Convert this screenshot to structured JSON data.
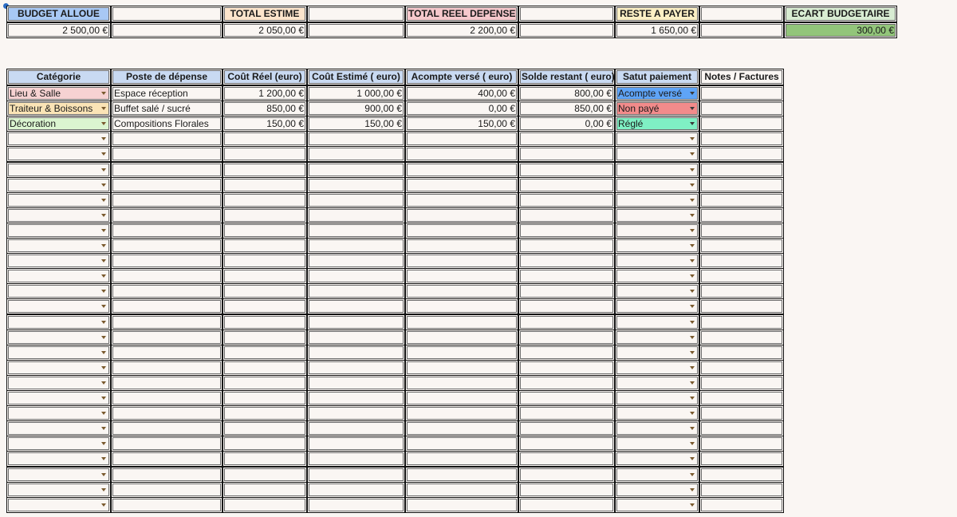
{
  "summary": [
    {
      "key": "budget",
      "label": "BUDGET ALLOUE",
      "value": "2 500,00 €",
      "label_bg": "#a8c8f4",
      "value_bg": "#faf6f3"
    },
    {
      "key": "blank1",
      "label": "",
      "value": "",
      "label_bg": "#faf6f3",
      "value_bg": "#faf6f3"
    },
    {
      "key": "estime",
      "label": "TOTAL ESTIME",
      "value": "2 050,00 €",
      "label_bg": "#fde5cc",
      "value_bg": "#faf6f3"
    },
    {
      "key": "blank2",
      "label": "",
      "value": "",
      "label_bg": "#faf6f3",
      "value_bg": "#faf6f3"
    },
    {
      "key": "reel",
      "label": "TOTAL REEL DEPENSE",
      "value": "2 200,00 €",
      "label_bg": "#f6c8cc",
      "value_bg": "#faf6f3"
    },
    {
      "key": "blank3",
      "label": "",
      "value": "",
      "label_bg": "#faf6f3",
      "value_bg": "#faf6f3"
    },
    {
      "key": "reste",
      "label": "RESTE A PAYER",
      "value": "1 650,00 €",
      "label_bg": "#fbefc4",
      "value_bg": "#faf6f3"
    },
    {
      "key": "blank4",
      "label": "",
      "value": "",
      "label_bg": "#faf6f3",
      "value_bg": "#faf6f3"
    },
    {
      "key": "ecart",
      "label": "ECART BUDGETAIRE",
      "value": "300,00 €",
      "label_bg": "#d8ecd2",
      "value_bg": "#92c57a"
    }
  ],
  "table": {
    "headers": [
      "Catégorie",
      "Poste de dépense",
      "Coût Réel (euro)",
      "Coût Estimé ( euro)",
      "Acompte versé ( euro)",
      "Solde restant ( euro)",
      "Satut paiement",
      "Notes / Factures"
    ],
    "header_bg": "#c9daf2",
    "rows": [
      {
        "categorie": "Lieu & Salle",
        "cat_bg": "#f6d2d2",
        "poste": "Espace réception",
        "reel": "1 200,00 €",
        "estime": "1 000,00 €",
        "acompte": "400,00 €",
        "solde": "800,00 €",
        "statut": "Acompte versé",
        "statut_bg": "#5fa4f7",
        "notes": ""
      },
      {
        "categorie": "Traiteur & Boissons",
        "cat_bg": "#fbe4b6",
        "poste": "Buffet salé / sucré",
        "reel": "850,00 €",
        "estime": "900,00 €",
        "acompte": "0,00 €",
        "solde": "850,00 €",
        "statut": "Non payé",
        "statut_bg": "#f28b8b",
        "notes": ""
      },
      {
        "categorie": "Décoration",
        "cat_bg": "#dbf5d0",
        "poste": "Compositions Florales",
        "reel": "150,00 €",
        "estime": "150,00 €",
        "acompte": "150,00 €",
        "solde": "0,00 €",
        "statut": "Réglé",
        "statut_bg": "#7ff0c4",
        "notes": ""
      }
    ],
    "empty_rows": 25
  }
}
